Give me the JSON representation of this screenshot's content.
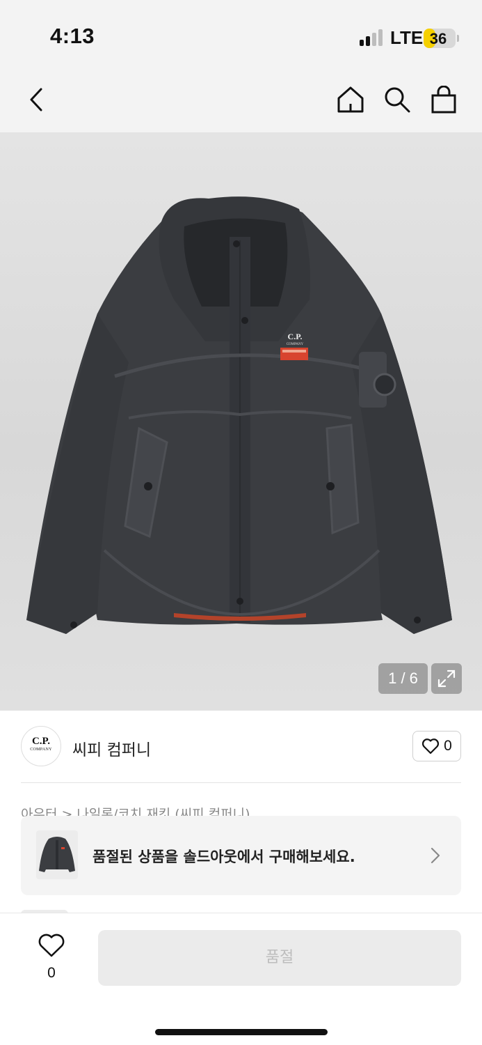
{
  "status": {
    "time": "4:13",
    "network": "LTE",
    "battery": "36",
    "battery_level": 0.36
  },
  "nav": {
    "back_icon": "chevron-left-icon",
    "home_icon": "home-icon",
    "search_icon": "search-icon",
    "cart_icon": "shopping-bag-icon"
  },
  "gallery": {
    "pager": "1 / 6",
    "expand_icon": "expand-icon",
    "logo_line1": "C.P.",
    "logo_line2": "COMPANY"
  },
  "brand": {
    "logo_line1": "C.P.",
    "logo_line2": "COMPANY",
    "name": "씨피 컴퍼니",
    "like_count": "0"
  },
  "breadcrumb": "아우터 > 나일론/코치 재킷 (씨피 컴퍼니)",
  "soldout_banner": {
    "text": "품절된 상품을 솔드아웃에서 구매해보세요."
  },
  "bottom": {
    "wish_count": "0",
    "buy_label": "품절"
  },
  "colors": {
    "accent_battery": "#f5d000",
    "jacket": "#3b3d41",
    "label_red": "#d8442e"
  }
}
